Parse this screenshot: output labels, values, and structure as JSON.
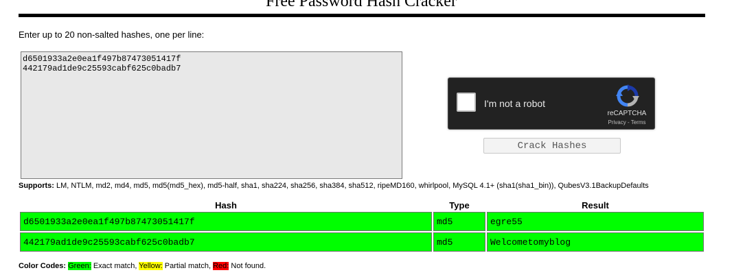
{
  "header": {
    "title": "Free Password Hash Cracker"
  },
  "form": {
    "instructions": "Enter up to 20 non-salted hashes, one per line:",
    "hashes_value": "d6501933a2e0ea1f497b87473051417f\n442179ad1de9c25593cabf625c0badb7",
    "crack_button_label": "Crack Hashes"
  },
  "recaptcha": {
    "label": "I'm not a robot",
    "brand": "reCAPTCHA",
    "links": "Privacy - Terms",
    "logo_icon": "recaptcha-logo-icon",
    "background": "#222222"
  },
  "supports": {
    "label": "Supports:",
    "text": "LM, NTLM, md2, md4, md5, md5(md5_hex), md5-half, sha1, sha224, sha256, sha384, sha512, ripeMD160, whirlpool, MySQL 4.1+ (sha1(sha1_bin)), QubesV3.1BackupDefaults"
  },
  "results": {
    "headers": [
      "Hash",
      "Type",
      "Result"
    ],
    "rows": [
      {
        "hash": "d6501933a2e0ea1f497b87473051417f",
        "type": "md5",
        "result": "egre55",
        "status": "exact",
        "color": "#00ff00"
      },
      {
        "hash": "442179ad1de9c25593cabf625c0badb7",
        "type": "md5",
        "result": "Welcometomyblog",
        "status": "exact",
        "color": "#00ff00"
      }
    ]
  },
  "legend": {
    "label": "Color Codes:",
    "green": "Green:",
    "green_desc": "Exact match,",
    "yellow": "Yellow:",
    "yellow_desc": "Partial match,",
    "red": "Red:",
    "red_desc": "Not found.",
    "colors": {
      "green": "#00ff00",
      "yellow": "#ffff00",
      "red": "#ff0000"
    }
  }
}
